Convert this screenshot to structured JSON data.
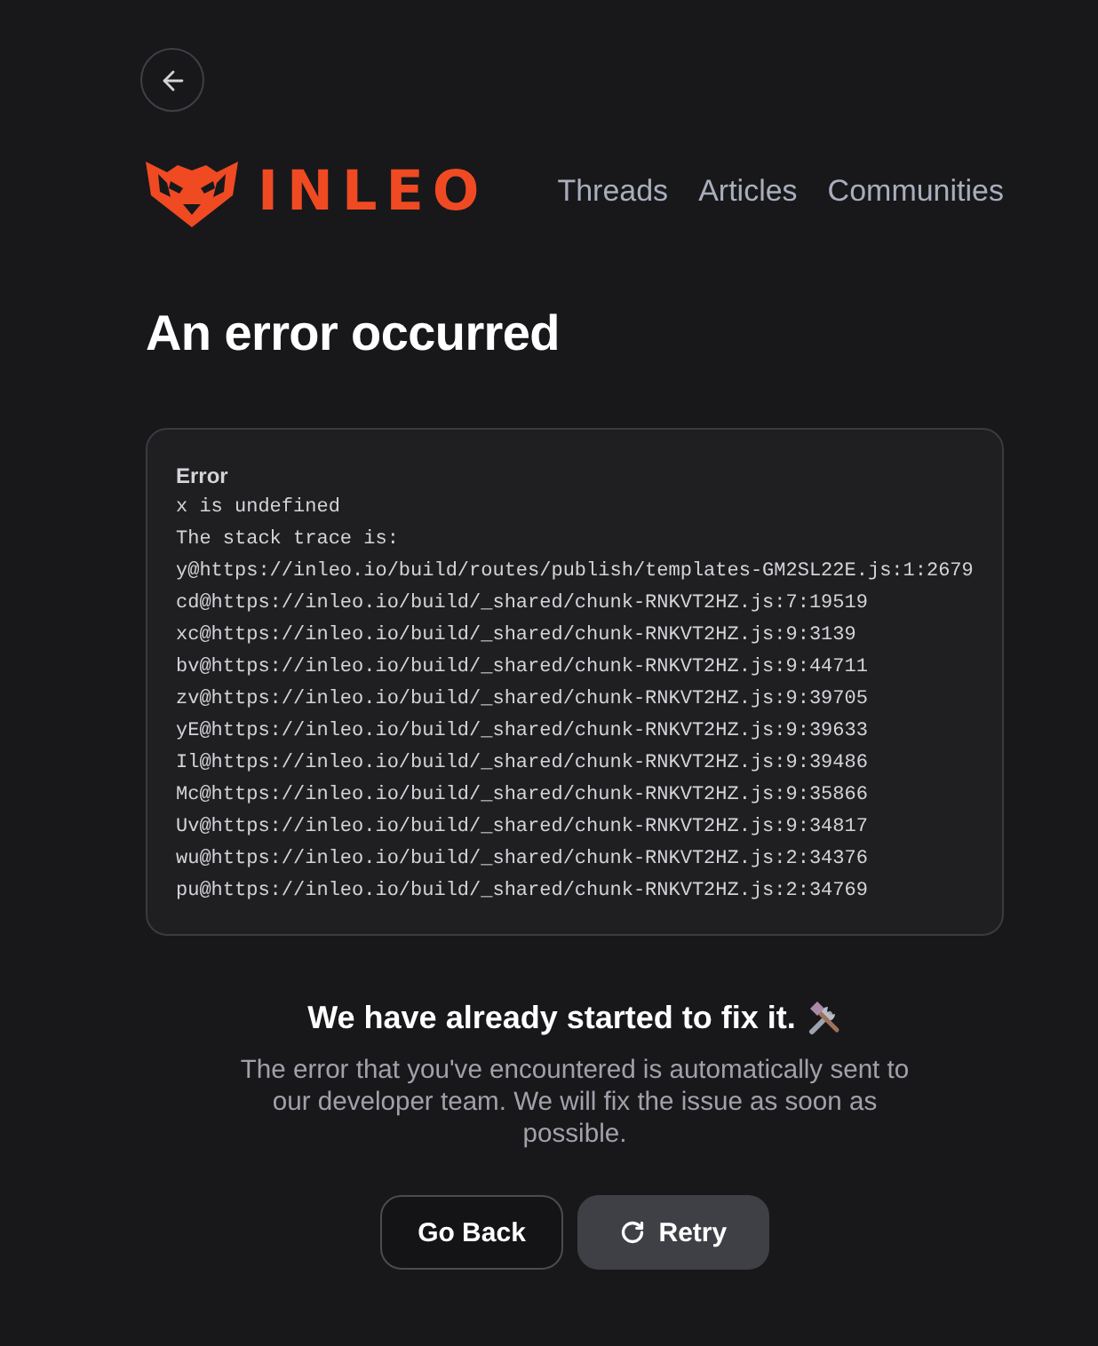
{
  "header": {
    "logo_text": "INLEO",
    "nav_links": [
      "Threads",
      "Articles",
      "Communities"
    ]
  },
  "title": "An error occurred",
  "error_box": {
    "heading": "Error",
    "lines": [
      "x is undefined",
      "The stack trace is:",
      "y@https://inleo.io/build/routes/publish/templates-GM2SL22E.js:1:2679",
      "cd@https://inleo.io/build/_shared/chunk-RNKVT2HZ.js:7:19519",
      "xc@https://inleo.io/build/_shared/chunk-RNKVT2HZ.js:9:3139",
      "bv@https://inleo.io/build/_shared/chunk-RNKVT2HZ.js:9:44711",
      "zv@https://inleo.io/build/_shared/chunk-RNKVT2HZ.js:9:39705",
      "yE@https://inleo.io/build/_shared/chunk-RNKVT2HZ.js:9:39633",
      "Il@https://inleo.io/build/_shared/chunk-RNKVT2HZ.js:9:39486",
      "Mc@https://inleo.io/build/_shared/chunk-RNKVT2HZ.js:9:35866",
      "Uv@https://inleo.io/build/_shared/chunk-RNKVT2HZ.js:9:34817",
      "wu@https://inleo.io/build/_shared/chunk-RNKVT2HZ.js:2:34376",
      "pu@https://inleo.io/build/_shared/chunk-RNKVT2HZ.js:2:34769"
    ]
  },
  "message": {
    "heading": "We have already started to fix it.",
    "body": "The error that you've encountered is automatically sent to our developer team. We will fix the issue as soon as possible."
  },
  "buttons": [
    {
      "kind": "outline",
      "label": "Go Back"
    },
    {
      "kind": "filled",
      "label": "Retry"
    }
  ]
}
